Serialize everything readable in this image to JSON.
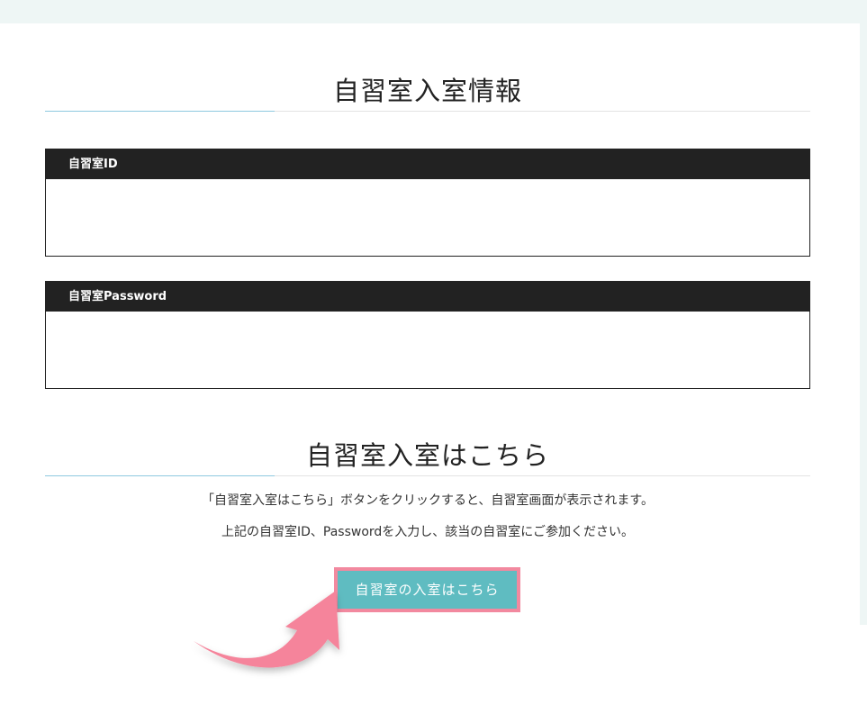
{
  "info_section": {
    "title": "自習室入室情報"
  },
  "fields": [
    {
      "label": "自習室ID",
      "value": ""
    },
    {
      "label": "自習室Password",
      "value": ""
    }
  ],
  "entry_section": {
    "title": "自習室入室はこちら",
    "description_line1": "「自習室入室はこちら」ボタンをクリックすると、自習室画面が表示されます。",
    "description_line2": "上記の自習室ID、Passwordを入力し、該当の自習室にご参加ください。",
    "button_label": "自習室の入室はこちら"
  },
  "colors": {
    "header_bg": "#222222",
    "accent_rule": "#8ec9e0",
    "button_bg": "#5fbcc1",
    "button_border": "#f2899f",
    "arrow": "#f5849b"
  }
}
